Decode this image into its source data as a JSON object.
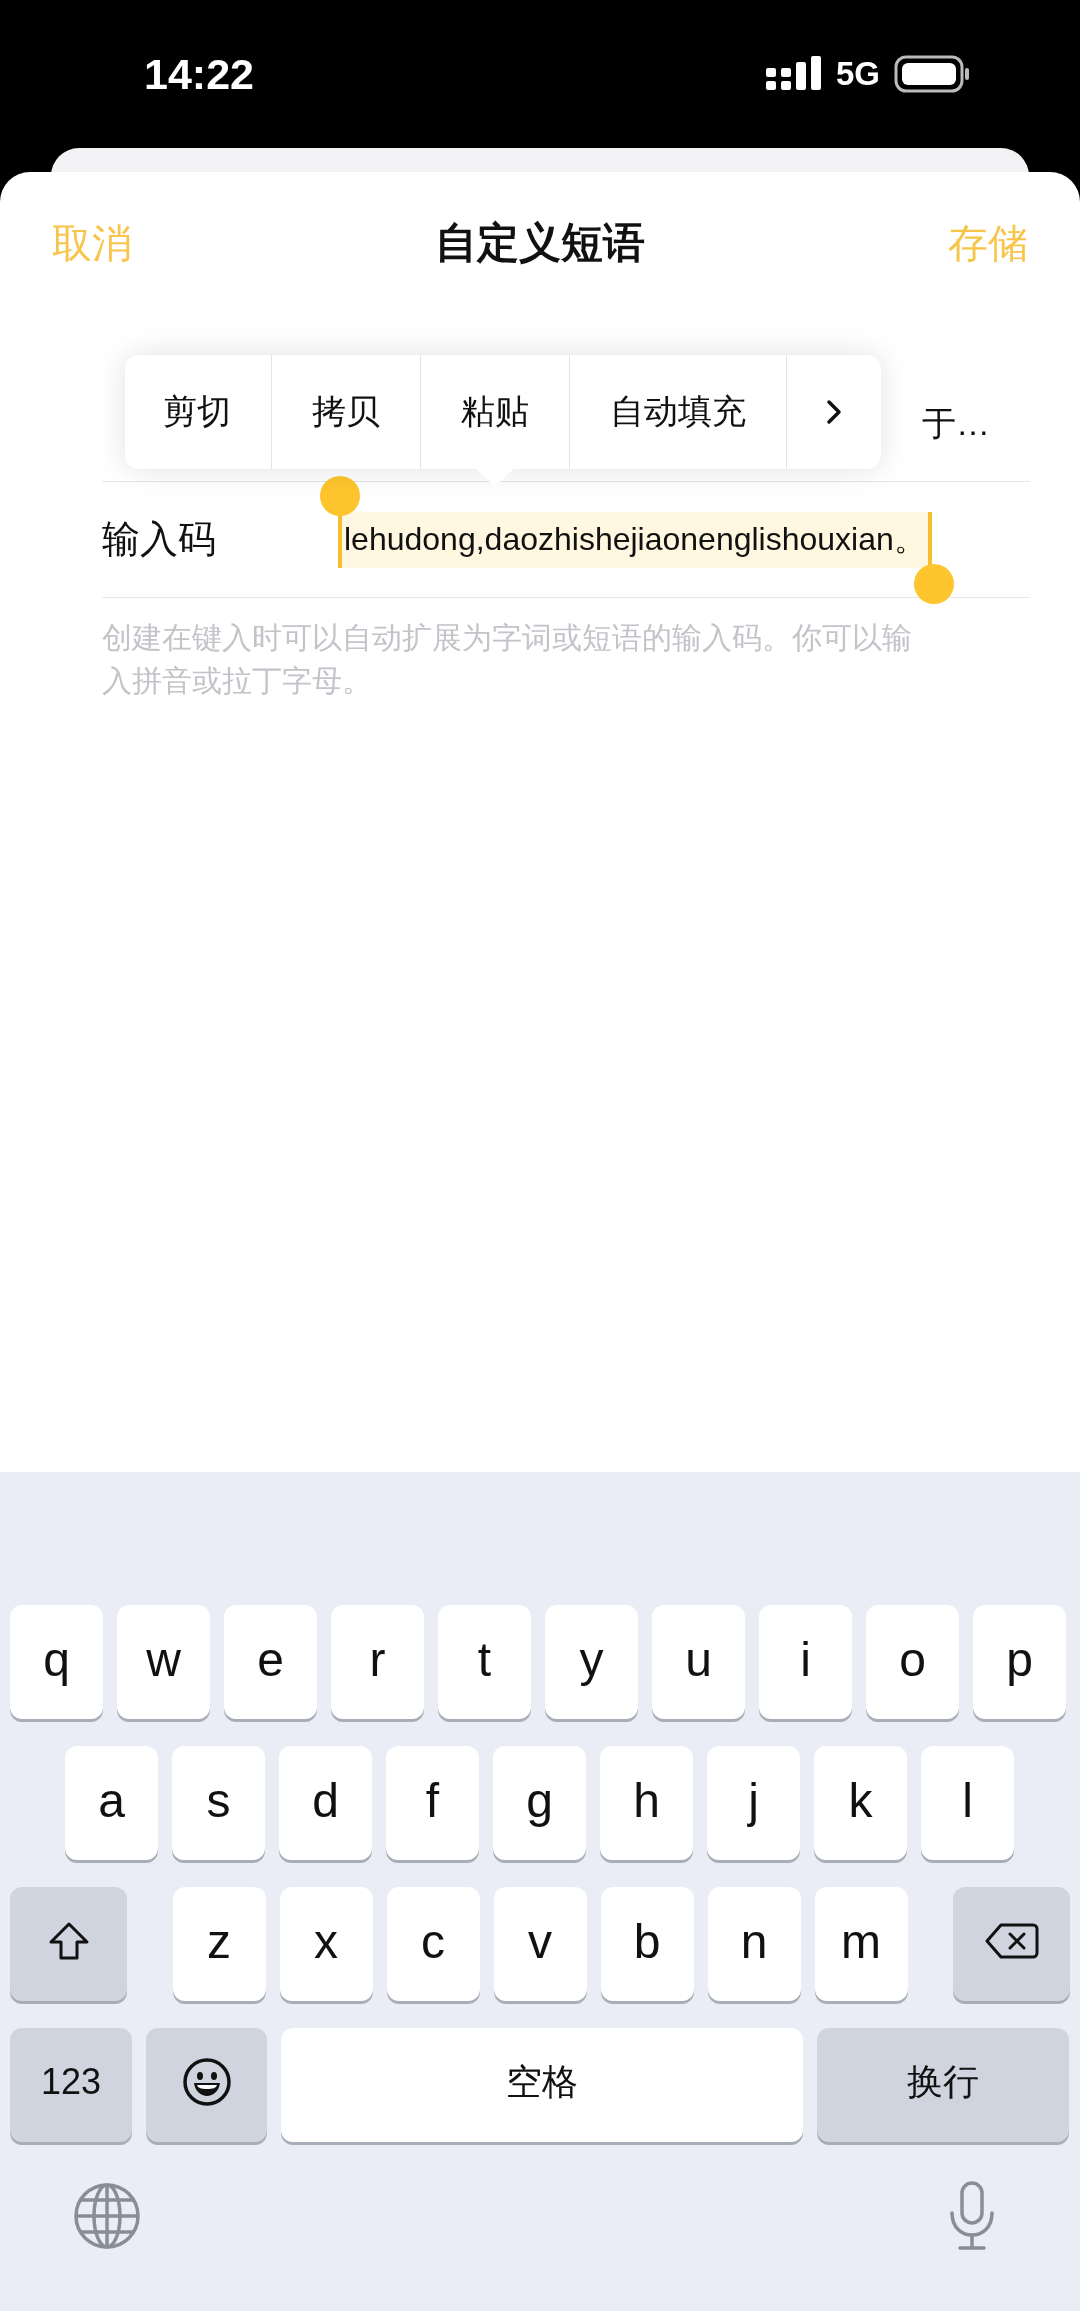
{
  "status_bar": {
    "time": "14:22",
    "network": "5G"
  },
  "nav": {
    "cancel": "取消",
    "title": "自定义短语",
    "save": "存储"
  },
  "form": {
    "rows": [
      {
        "kind": "phrase",
        "value": "于…"
      },
      {
        "kind": "shortcut",
        "label": "输入码",
        "value": "lehudong,daozhishejiaonenglishouxian。",
        "text_selected": true
      }
    ],
    "hint": "创建在键入时可以自动扩展为字词或短语的输入码。你可以输入拼音或拉丁字母。"
  },
  "edit_menu": {
    "items": [
      "剪切",
      "拷贝",
      "粘贴",
      "自动填充"
    ]
  },
  "keyboard": {
    "rows": [
      [
        "q",
        "w",
        "e",
        "r",
        "t",
        "y",
        "u",
        "i",
        "o",
        "p"
      ],
      [
        "a",
        "s",
        "d",
        "f",
        "g",
        "h",
        "j",
        "k",
        "l"
      ],
      [
        "z",
        "x",
        "c",
        "v",
        "b",
        "n",
        "m"
      ]
    ],
    "numbers": "123",
    "space": "空格",
    "return": "换行"
  }
}
